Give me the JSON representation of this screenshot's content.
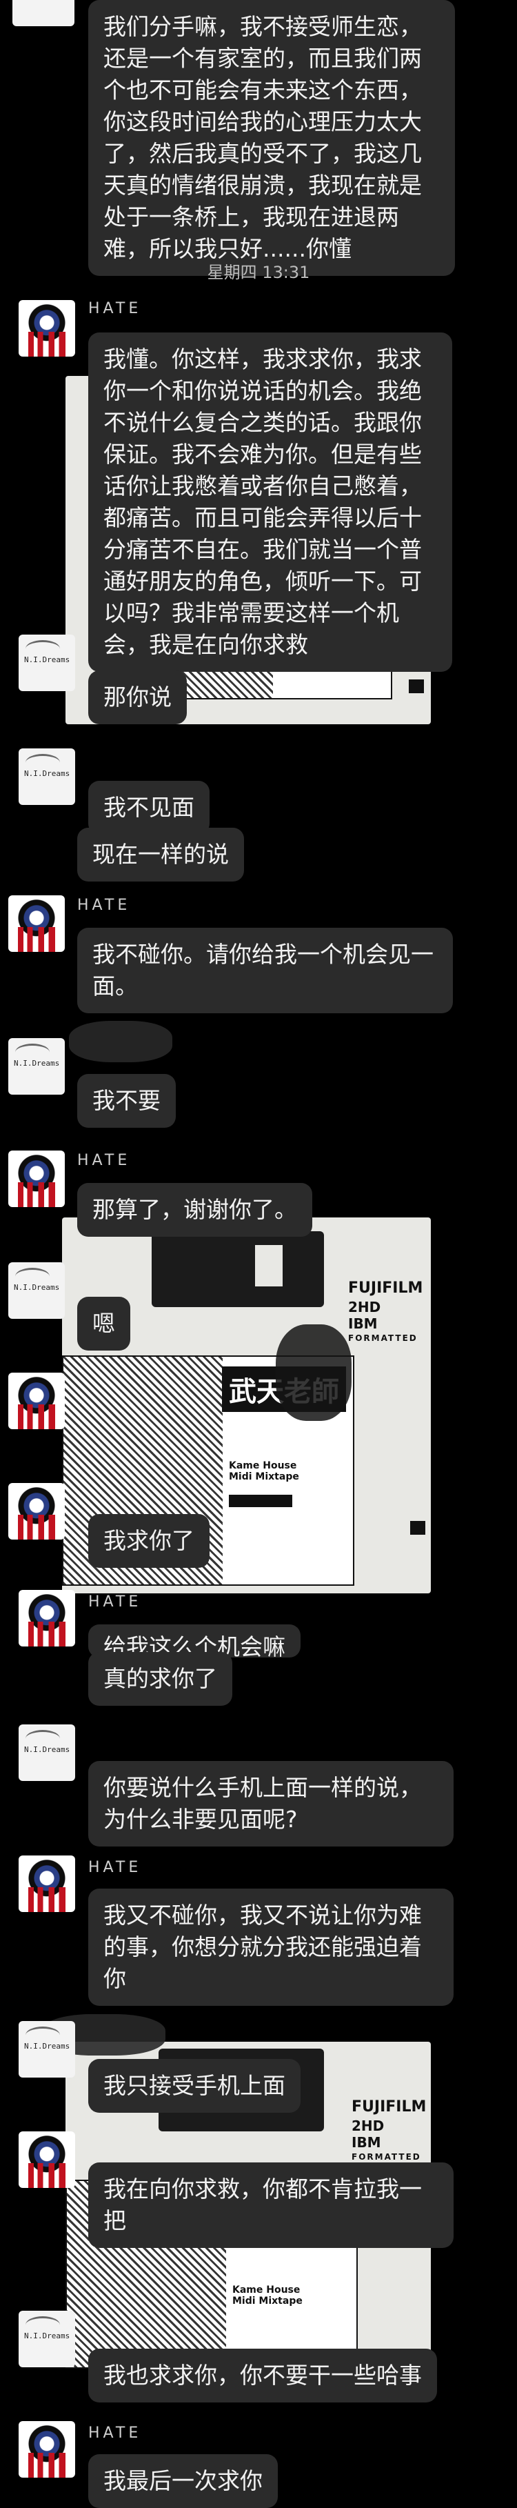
{
  "timestamp": "星期四 13:31",
  "sender_name": "HATE",
  "floppy": {
    "brand": "FUJIFILM",
    "spec": "2HD",
    "format": "IBM",
    "formatted": "FORMATTED",
    "cjk_title": "武天老師",
    "tape_title": "Kame House\nMidi Mixtape"
  },
  "avatars": {
    "hate": "bleeding-eye-avatar",
    "other": "N.I.Dreams"
  },
  "messages": [
    {
      "id": "m1",
      "from": "other",
      "text": "我们分手嘛，我不接受师生恋，还是一个有家室的，而且我们两个也不可能会有未来这个东西，你这段时间给我的心理压力太大了，然后我真的受不了，我这几天真的情绪很崩溃，我现在就是处于一条桥上，我现在进退两难，所以我只好......你懂"
    },
    {
      "id": "m2",
      "from": "hate",
      "text": "我懂。你这样，我求求你，我求你一个和你说说话的机会。我绝不说什么复合之类的话。我跟你保证。我不会难为你。但是有些话你让我憋着或者你自己憋着，都痛苦。而且可能会弄得以后十分痛苦不自在。我们就当一个普通好朋友的角色，倾听一下。可以吗？我非常需要这样一个机会，我是在向你求救"
    },
    {
      "id": "m3",
      "from": "other",
      "text": "那你说"
    },
    {
      "id": "m4",
      "from": "other",
      "text": "我不见面"
    },
    {
      "id": "m5",
      "from": "other",
      "text": "现在一样的说"
    },
    {
      "id": "m6",
      "from": "hate",
      "text": "我不碰你。请你给我一个机会见一面。"
    },
    {
      "id": "m7",
      "from": "other",
      "text": "我不要"
    },
    {
      "id": "m8",
      "from": "hate",
      "text": "那算了，谢谢你了。"
    },
    {
      "id": "m9",
      "from": "other",
      "text": "嗯"
    },
    {
      "id": "m10",
      "from": "hate",
      "text": "我求你了"
    },
    {
      "id": "m11",
      "from": "hate",
      "text": "给我这么个机会嘛"
    },
    {
      "id": "m12",
      "from": "hate",
      "text": "真的求你了"
    },
    {
      "id": "m13",
      "from": "other",
      "text": "你要说什么手机上面一样的说，为什么非要见面呢?"
    },
    {
      "id": "m14",
      "from": "hate",
      "text": "我又不碰你，我又不说让你为难的事，你想分就分我还能强迫着你"
    },
    {
      "id": "m15",
      "from": "other",
      "text": "我只接受手机上面"
    },
    {
      "id": "m16",
      "from": "hate",
      "text": "我在向你求救，你都不肯拉我一把"
    },
    {
      "id": "m17",
      "from": "other",
      "text": "我也求求你，你不要干一些哈事"
    },
    {
      "id": "m18",
      "from": "hate",
      "text": "我最后一次求你"
    }
  ]
}
